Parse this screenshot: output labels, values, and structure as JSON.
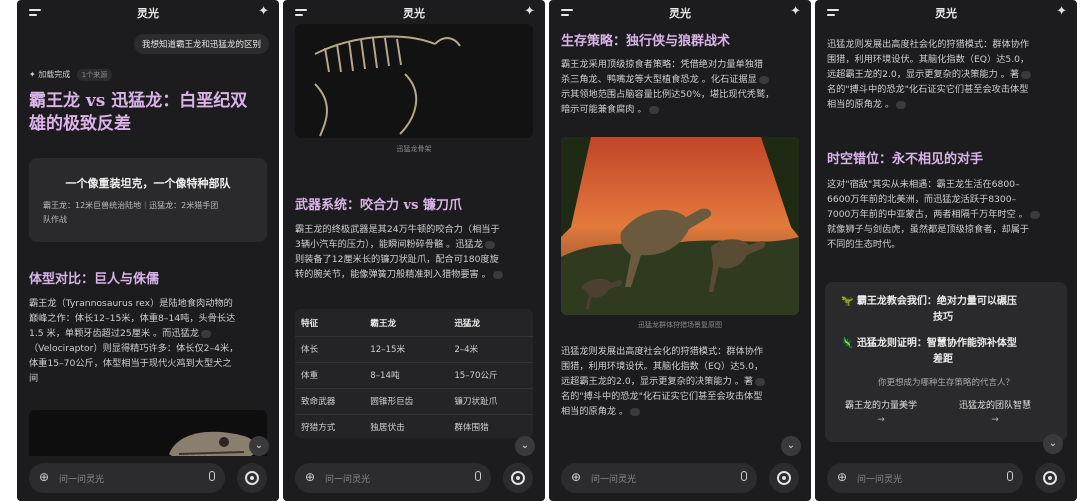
{
  "app": {
    "title": "灵光",
    "input_placeholder": "问一问灵光"
  },
  "panel1": {
    "user_message": "我想知道霸王龙和迅猛龙的区别",
    "status": "加载完成",
    "status_tag": "1个来源",
    "title_line1": "霸王龙 vs 迅猛龙：白垩纪双",
    "title_line2": "雄的极致反差",
    "card_title": "一个像重装坦克，一个像特种部队",
    "card_sub_line1": "霸王龙：12米巨兽统治陆地｜迅猛龙：2米猎手团",
    "card_sub_line2": "队作战",
    "section_heading": "体型对比：巨人与侏儒",
    "para_lines": [
      "霸王龙（Tyrannosaurus rex）是陆地食肉动物的",
      "巅峰之作：体长12–15米，体重8–14吨，头骨长达",
      "1.5 米，单颗牙齿超过25厘米 。而迅猛龙",
      "（Velociraptor）则显得精巧许多：体长仅2–4米，",
      "体重15–70公斤，体型相当于现代火鸡到大型犬之",
      "间"
    ]
  },
  "panel2": {
    "image_caption": "迅猛龙骨架",
    "section_heading": "武器系统：咬合力 vs 镰刀爪",
    "para_lines": [
      "霸王龙的终极武器是其24万牛顿的咬合力（相当于",
      "3辆小汽车的压力），能瞬间粉碎骨骼 。迅猛龙",
      "则装备了12厘米长的镰刀状趾爪，配合可180度旋",
      "转的腕关节，能像弹簧刀般精准刺入猎物要害 。"
    ],
    "table": {
      "headers": [
        "特征",
        "霸王龙",
        "迅猛龙"
      ],
      "rows": [
        [
          "体长",
          "12–15米",
          "2–4米"
        ],
        [
          "体重",
          "8–14吨",
          "15–70公斤"
        ],
        [
          "致命武器",
          "圆锥形巨齿",
          "镰刀状趾爪"
        ],
        [
          "狩猎方式",
          "独居伏击",
          "群体围猎"
        ]
      ]
    }
  },
  "panel3": {
    "section_heading": "生存策略：独行侠与狼群战术",
    "para1_lines": [
      "霸王龙采用顶级掠食者策略：凭借绝对力量单独猎",
      "杀三角龙、鸭嘴龙等大型植食恐龙 。化石证据显",
      "示其领地范围占脑容量比例达50%，堪比现代秃鹫，",
      "暗示可能兼食腐肉 。"
    ],
    "image_caption": "迅猛龙群体狩猎场景复原图",
    "para2_lines": [
      "迅猛龙则发展出高度社会化的狩猎模式：群体协作",
      "围猎，利用环境设伏。其脑化指数（EQ）达5.0，",
      "远超霸王龙的2.0，显示更复杂的决策能力 。著",
      "名的\"搏斗中的恐龙\"化石证实它们甚至会攻击体型",
      "相当的原角龙 。"
    ]
  },
  "panel4": {
    "para1_lines": [
      "迅猛龙则发展出高度社会化的狩猎模式：群体协作",
      "围猎，利用环境设伏。其脑化指数（EQ）达5.0，",
      "远超霸王龙的2.0，显示更复杂的决策能力 。著",
      "名的\"搏斗中的恐龙\"化石证实它们甚至会攻击体型",
      "相当的原角龙 。"
    ],
    "section_heading": "时空错位：永不相见的对手",
    "para2_lines": [
      "这对\"宿敌\"其实从未相遇：霸王龙生活在6800–",
      "6600万年前的北美洲，而迅猛龙活跃于8300–",
      "7000万年前的中亚蒙古，两者相隔千万年时空 。",
      "就像狮子与剑齿虎，虽然都是顶级掠食者，却属于",
      "不同的生态时代。"
    ],
    "lesson1_line1": "霸王龙教会我们：绝对力量可以碾压",
    "lesson1_line2": "技巧",
    "lesson2_line1": "迅猛龙则证明：智慧协作能弥补体型",
    "lesson2_line2": "差距",
    "question": "你更想成为哪种生存策略的代言人？",
    "option1": "霸王龙的力量美学",
    "option2": "迅猛龙的团队智慧"
  }
}
